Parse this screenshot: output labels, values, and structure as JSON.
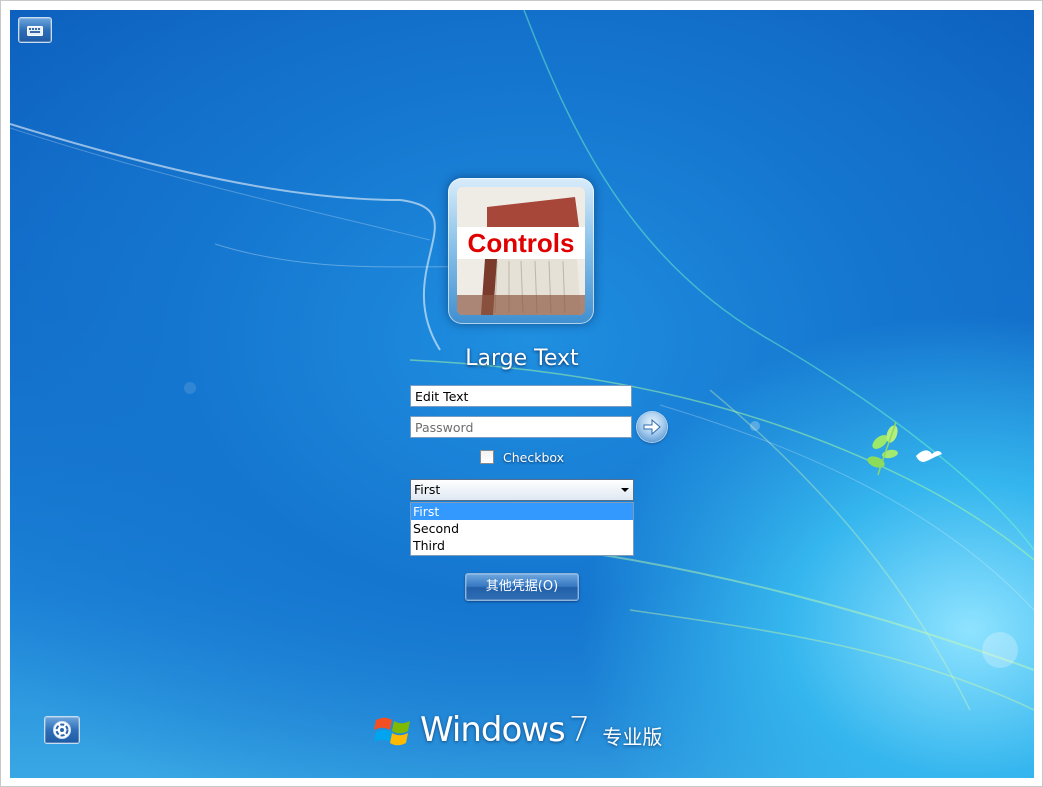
{
  "user": {
    "tile_label": "Controls",
    "name": "Large Text"
  },
  "form": {
    "edit_value": "Edit Text",
    "password_placeholder": "Password",
    "checkbox_label": "Checkbox",
    "checkbox_checked": false,
    "select_value": "First",
    "options": [
      "First",
      "Second",
      "Third"
    ],
    "selected_option": "First"
  },
  "other_credentials_label": "其他凭据(O)",
  "brand": {
    "word": "Windows",
    "version": "7",
    "edition": "专业版"
  },
  "icons": {
    "top_left": "keyboard-icon",
    "bottom_left": "ease-of-access-icon",
    "submit": "arrow-right-icon",
    "logo": "windows-flag-icon"
  },
  "colors": {
    "background": "#1576cf",
    "selection": "#3399ff",
    "tile_text": "#e00000"
  }
}
